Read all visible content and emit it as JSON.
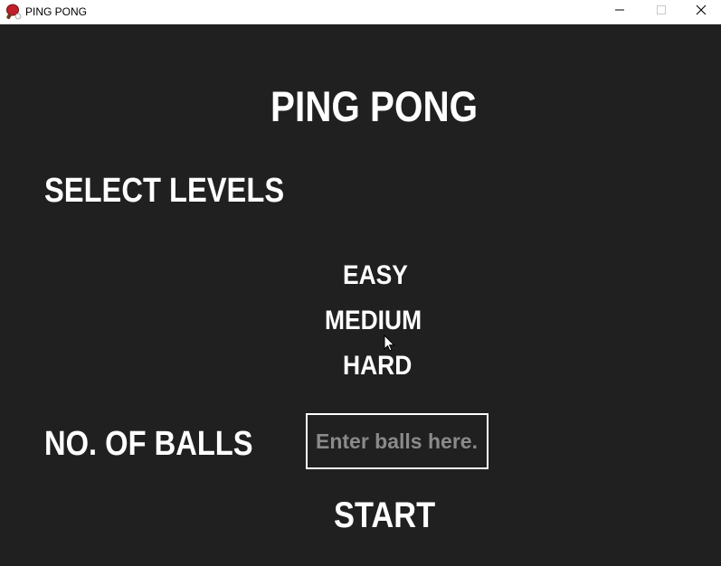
{
  "window": {
    "title": "PING PONG",
    "app_icon": "ping-pong-paddle-icon",
    "controls": {
      "minimize_icon": "minimize-icon",
      "maximize_icon": "maximize-icon",
      "close_icon": "close-icon"
    }
  },
  "main": {
    "title": "PING PONG",
    "select_levels_label": "SELECT LEVELS",
    "levels": [
      "EASY",
      "MEDIUM",
      "HARD"
    ],
    "balls_label": "NO. OF BALLS",
    "balls_input": {
      "value": "",
      "placeholder": "Enter balls here."
    },
    "start_label": "START"
  },
  "colors": {
    "background": "#202020",
    "text": "#ffffff",
    "placeholder": "#8a8a8a",
    "titlebar": "#ffffff",
    "icon_red": "#c0202a"
  }
}
